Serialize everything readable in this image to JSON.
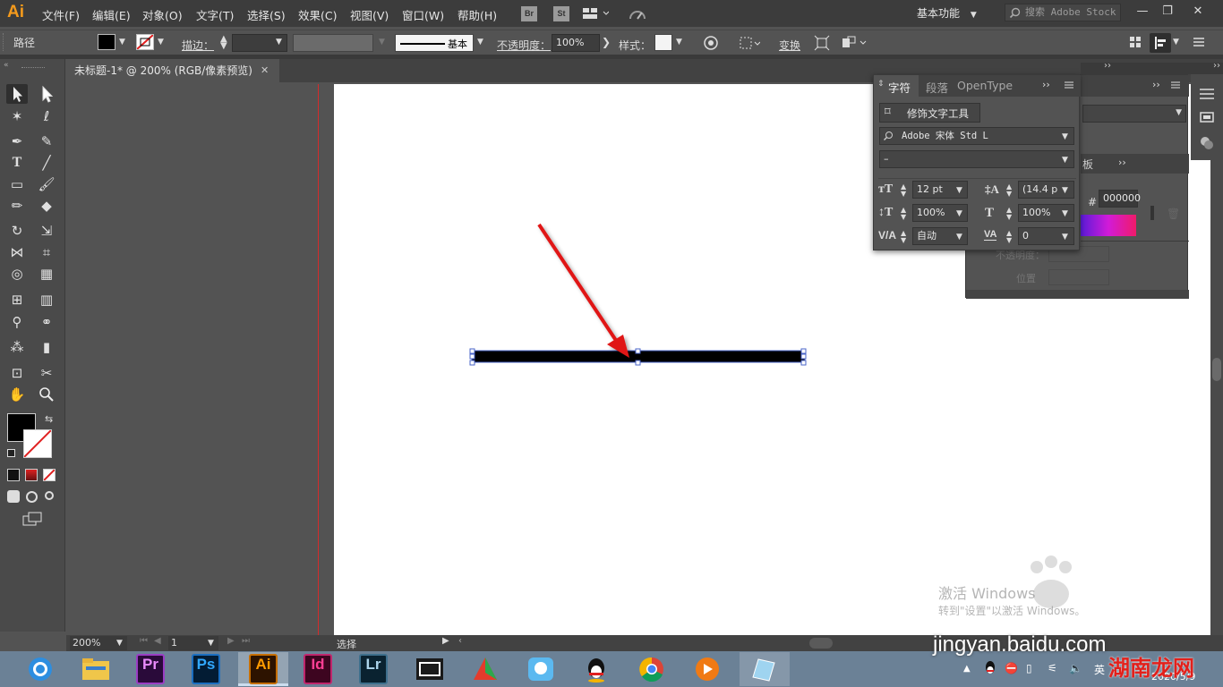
{
  "app": {
    "logo_text": "Ai",
    "workspace": "基本功能",
    "stock_search_placeholder": "搜索 Adobe Stock"
  },
  "menu": [
    "文件(F)",
    "编辑(E)",
    "对象(O)",
    "文字(T)",
    "选择(S)",
    "效果(C)",
    "视图(V)",
    "窗口(W)",
    "帮助(H)"
  ],
  "app_buttons": [
    "Br",
    "St"
  ],
  "window_controls": [
    "—",
    "❐",
    "✕"
  ],
  "control_bar": {
    "selection_type": "路径",
    "stroke_label": "描边：",
    "stroke_weight": "",
    "brush_label": "基本",
    "opacity_label": "不透明度：",
    "opacity_value": "100%",
    "style_label": "样式：",
    "transform_label": "变换"
  },
  "document_tab": {
    "title": "未标题-1* @ 200% (RGB/像素预览)",
    "close": "✕"
  },
  "character_panel": {
    "tabs": [
      "字符",
      "段落",
      "OpenType"
    ],
    "touch_tool_label": "修饰文字工具",
    "font_family": "Adobe 宋体 Std L",
    "font_style": "–",
    "font_size": "12 pt",
    "leading": "(14.4 p",
    "vertical_scale": "100%",
    "horizontal_scale": "100%",
    "kerning": "自动",
    "tracking": "0"
  },
  "color_panel": {
    "partial_tab": "板",
    "hex_prefix": "#",
    "hex_value": "000000",
    "opacity_label": "不透明度：",
    "position_label": "位置"
  },
  "status_bar": {
    "zoom": "200%",
    "artboard_number": "1",
    "tool_name": "选择"
  },
  "fill_color": "#000000",
  "line_color": "#000000",
  "arrow_color": "#e01818",
  "watermark": {
    "activate": "激活 Windows",
    "activate_sub": "转到\"设置\"以激活 Windows。",
    "site": "jingyan.baidu.com",
    "brand": "湖南龙网"
  },
  "taskbar": {
    "apps": [
      "Pr",
      "Ps",
      "Ai",
      "Id",
      "Lr"
    ],
    "date": "2020/5/9",
    "ime": "英"
  }
}
